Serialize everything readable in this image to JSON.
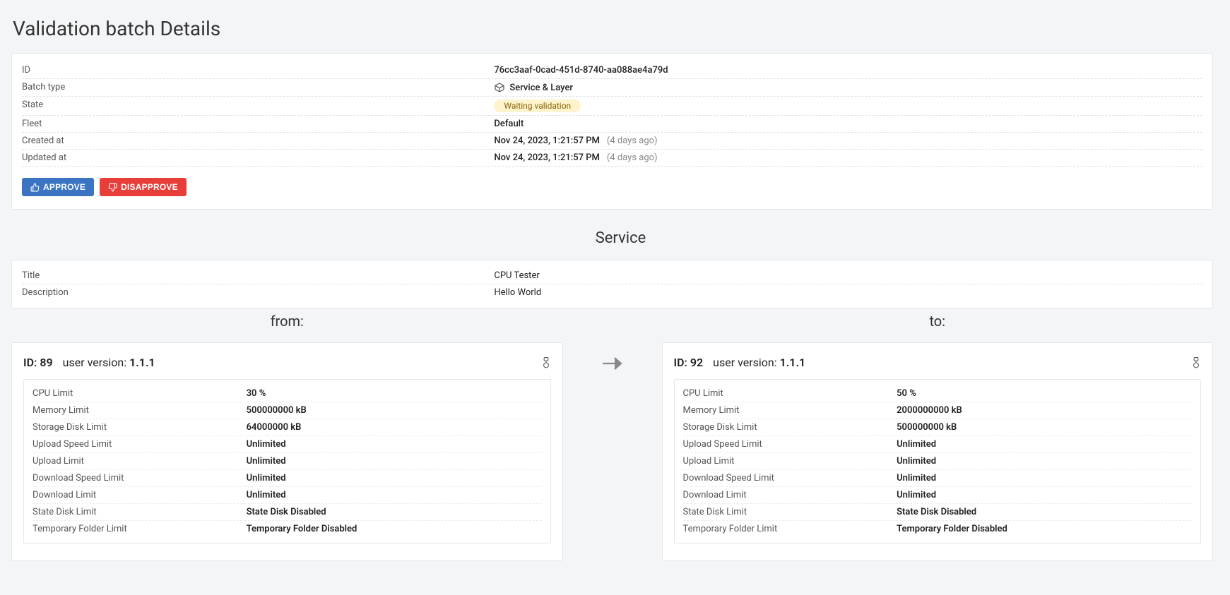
{
  "page_title": "Validation batch Details",
  "details": {
    "id_label": "ID",
    "id_value": "76cc3aaf-0cad-451d-8740-aa088ae4a79d",
    "batch_type_label": "Batch type",
    "batch_type_value": "Service & Layer",
    "state_label": "State",
    "state_value": "Waiting validation",
    "fleet_label": "Fleet",
    "fleet_value": "Default",
    "created_label": "Created at",
    "created_value": "Nov 24, 2023, 1:21:57 PM",
    "created_ago": "(4 days ago)",
    "updated_label": "Updated at",
    "updated_value": "Nov 24, 2023, 1:21:57 PM",
    "updated_ago": "(4 days ago)"
  },
  "buttons": {
    "approve": "APPROVE",
    "disapprove": "DISAPPROVE"
  },
  "service": {
    "section_title": "Service",
    "title_label": "Title",
    "title_value": "CPU Tester",
    "description_label": "Description",
    "description_value": "Hello World"
  },
  "compare": {
    "from_label": "from:",
    "to_label": "to:",
    "id_prefix": "ID: ",
    "version_prefix": "user version: "
  },
  "from": {
    "id": "89",
    "version": "1.1.1",
    "specs": {
      "cpu_label": "CPU Limit",
      "cpu_value": "30 %",
      "mem_label": "Memory Limit",
      "mem_value": "500000000 kB",
      "storage_label": "Storage Disk Limit",
      "storage_value": "64000000 kB",
      "upspeed_label": "Upload Speed Limit",
      "upspeed_value": "Unlimited",
      "uplimit_label": "Upload Limit",
      "uplimit_value": "Unlimited",
      "downspeed_label": "Download Speed Limit",
      "downspeed_value": "Unlimited",
      "downlimit_label": "Download Limit",
      "downlimit_value": "Unlimited",
      "statedisk_label": "State Disk Limit",
      "statedisk_value": "State Disk Disabled",
      "tmp_label": "Temporary Folder Limit",
      "tmp_value": "Temporary Folder Disabled"
    }
  },
  "to": {
    "id": "92",
    "version": "1.1.1",
    "specs": {
      "cpu_label": "CPU Limit",
      "cpu_value": "50 %",
      "mem_label": "Memory Limit",
      "mem_value": "2000000000 kB",
      "storage_label": "Storage Disk Limit",
      "storage_value": "500000000 kB",
      "upspeed_label": "Upload Speed Limit",
      "upspeed_value": "Unlimited",
      "uplimit_label": "Upload Limit",
      "uplimit_value": "Unlimited",
      "downspeed_label": "Download Speed Limit",
      "downspeed_value": "Unlimited",
      "downlimit_label": "Download Limit",
      "downlimit_value": "Unlimited",
      "statedisk_label": "State Disk Limit",
      "statedisk_value": "State Disk Disabled",
      "tmp_label": "Temporary Folder Limit",
      "tmp_value": "Temporary Folder Disabled"
    }
  }
}
